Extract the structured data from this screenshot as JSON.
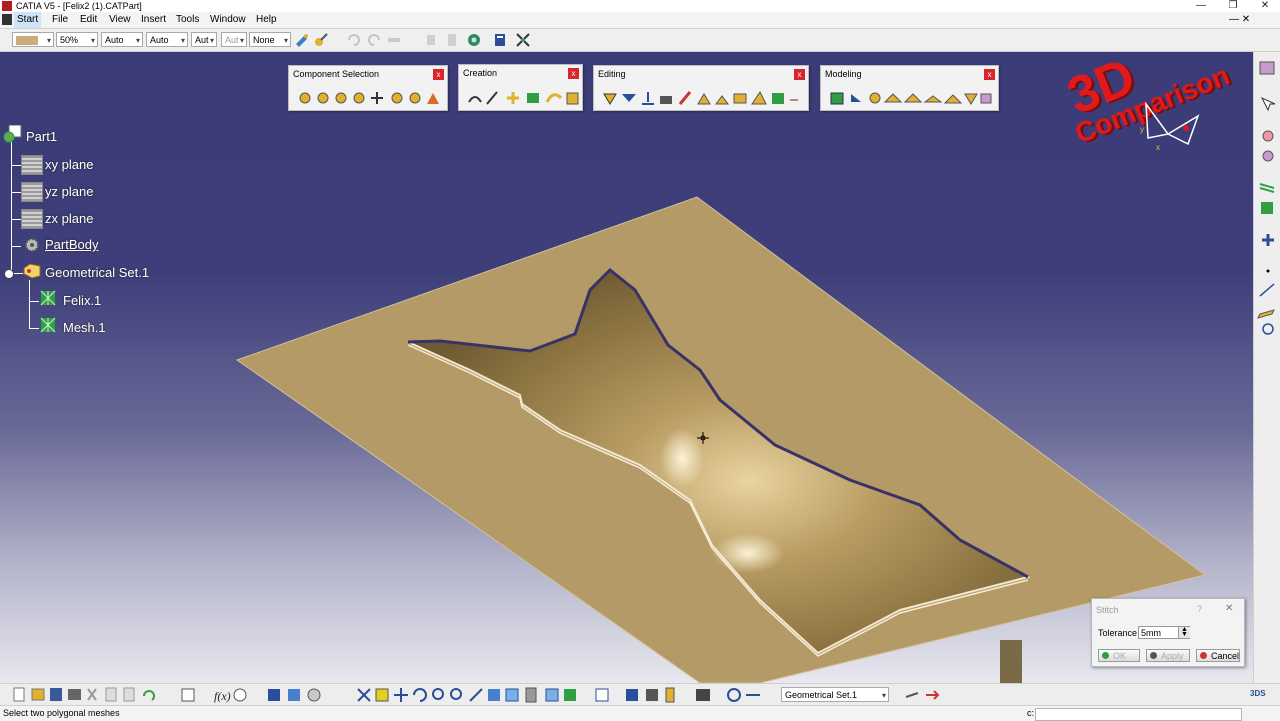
{
  "window": {
    "title": "CATIA V5 - [Felix2 (1).CATPart]",
    "minimize": "—",
    "restore": "❐",
    "close": "✕"
  },
  "menu": {
    "items": [
      "Start",
      "File",
      "Edit",
      "View",
      "Insert",
      "Tools",
      "Window",
      "Help"
    ]
  },
  "toolbar_top": {
    "zoom": "50%",
    "line_weight": "Auto",
    "line_type": "Auto",
    "layer1": "Aut",
    "layer2": "Aut",
    "material": "None"
  },
  "toolbars": {
    "component_selection": "Component Selection",
    "creation": "Creation",
    "editing": "Editing",
    "modeling": "Modeling",
    "close": "x"
  },
  "tree": {
    "root": "Part1",
    "xy": "xy plane",
    "yz": "yz plane",
    "zx": "zx plane",
    "partbody": "PartBody",
    "geoset": "Geometrical Set.1",
    "felix": "Felix.1",
    "mesh": "Mesh.1"
  },
  "watermark": {
    "line1": "3D",
    "line2": "Comparison"
  },
  "compass": {
    "x": "x",
    "y": "y"
  },
  "stitch_dialog": {
    "title": "Stitch",
    "help": "?",
    "close": "✕",
    "tolerance_label": "Tolerance :",
    "tolerance_value": "5mm",
    "ok": "OK",
    "apply": "Apply",
    "cancel": "Cancel"
  },
  "bottom_toolbar": {
    "current_set": "Geometrical Set.1"
  },
  "status": {
    "message": "Select two polygonal meshes",
    "prompt": "c:"
  },
  "colors": {
    "viewport_top": "#3b3b77",
    "plate": "#b39a67",
    "tree_text": "#ffffff",
    "watermark": "#e01a1a"
  }
}
